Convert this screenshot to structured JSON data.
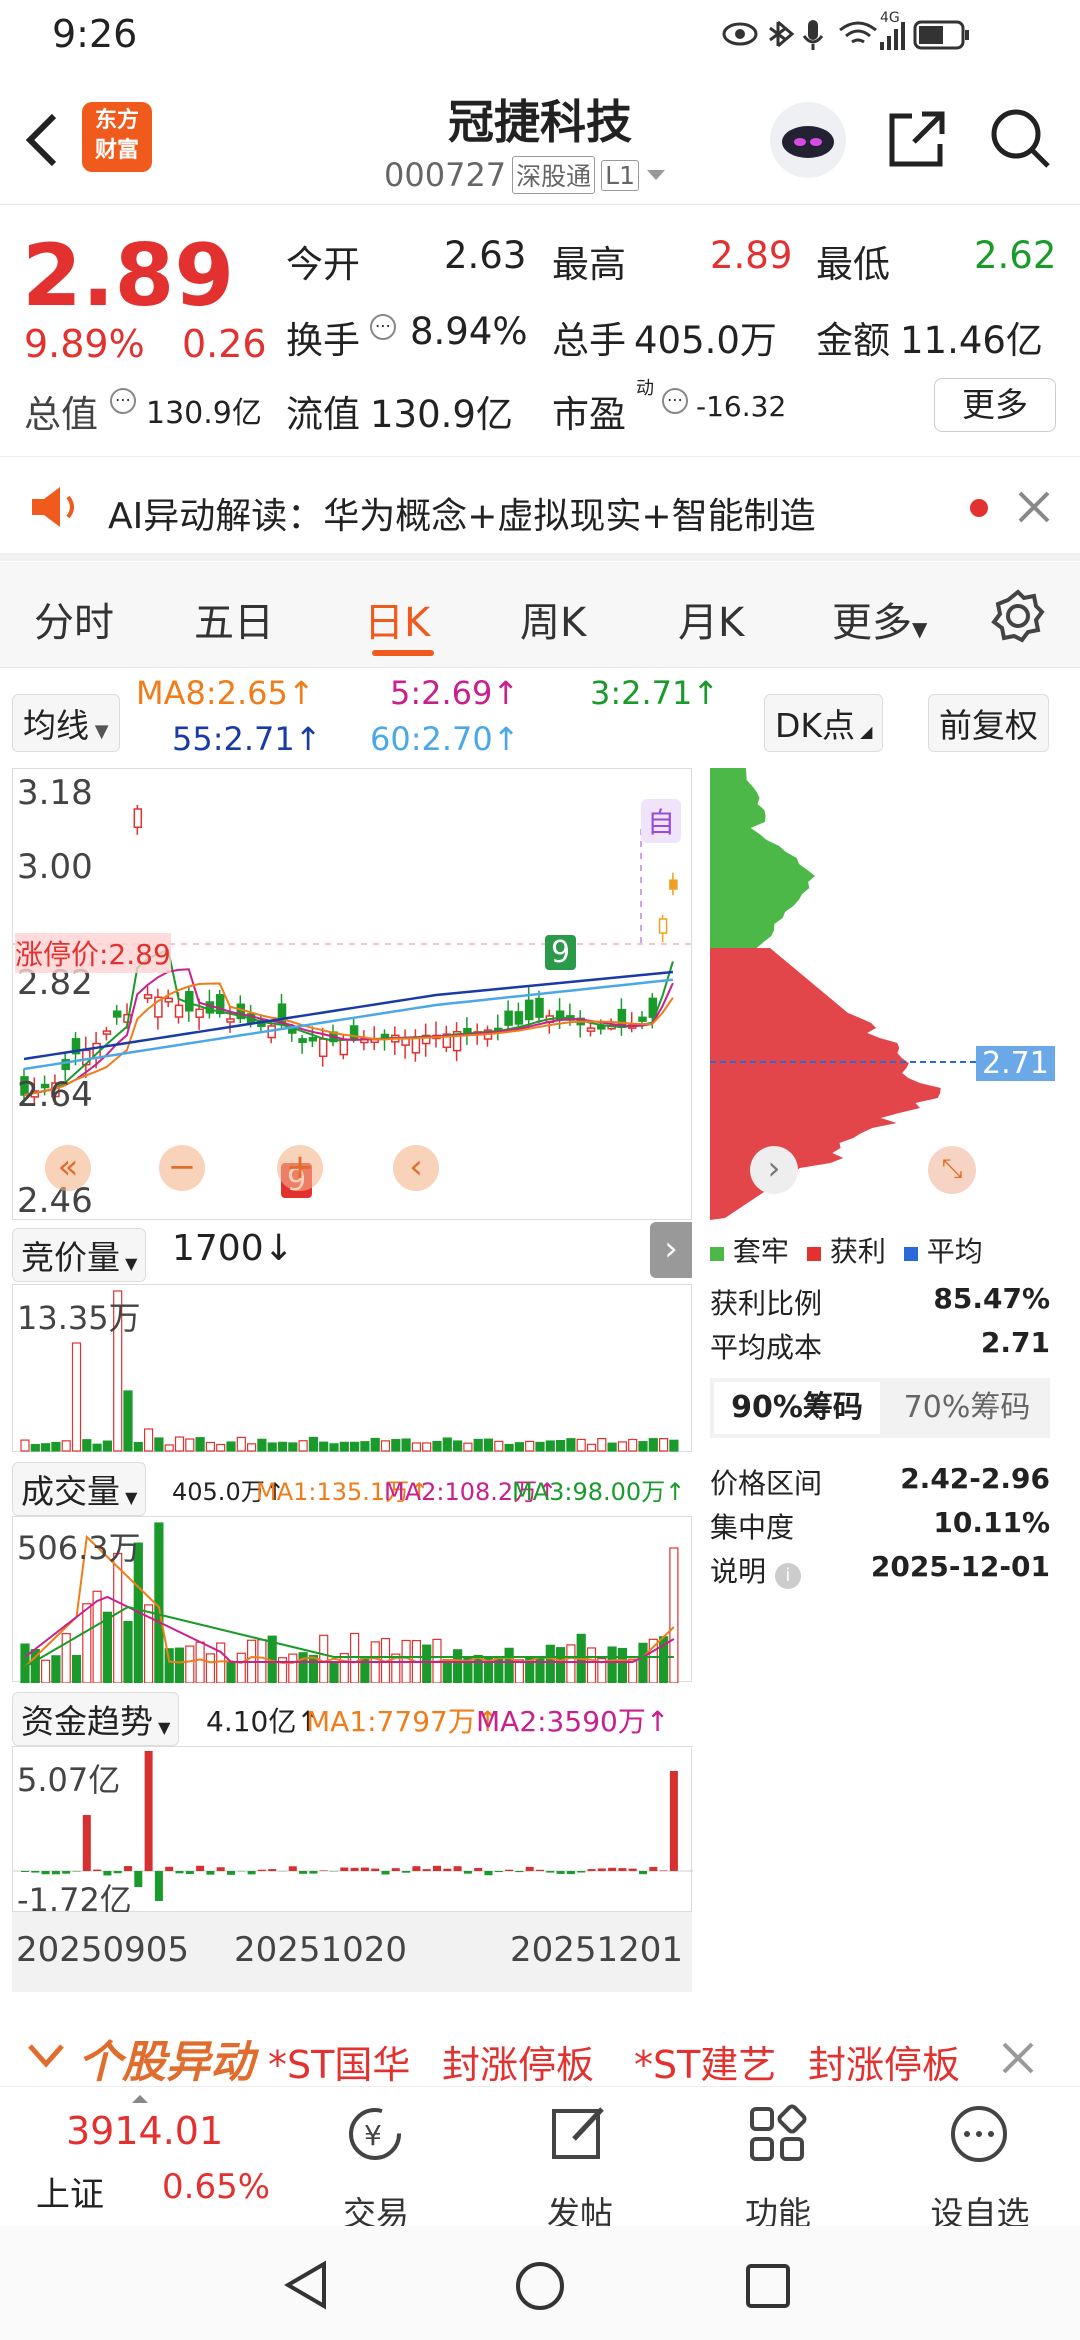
{
  "status": {
    "time": "9:26",
    "net": "4G"
  },
  "header": {
    "logo_line1": "东方",
    "logo_line2": "财富",
    "name": "冠捷科技",
    "code": "000727",
    "tag": "深股通",
    "level": "L1"
  },
  "quote": {
    "price": "2.89",
    "pct": "9.89%",
    "chg": "0.26",
    "open_l": "今开",
    "open_v": "2.63",
    "high_l": "最高",
    "high_v": "2.89",
    "low_l": "最低",
    "low_v": "2.62",
    "turn_l": "换手",
    "turn_v": "8.94%",
    "vol_l": "总手",
    "vol_v": "405.0万",
    "amt_l": "金额",
    "amt_v": "11.46亿",
    "mcap_l": "总值",
    "mcap_v": "130.9亿",
    "fcap_l": "流值",
    "fcap_v": "130.9亿",
    "pe_l": "市盈",
    "pe_sup": "动",
    "pe_v": "-16.32",
    "more": "更多"
  },
  "banner": {
    "text": "AI异动解读：华为概念+虚拟现实+智能制造"
  },
  "tabs": [
    "分时",
    "五日",
    "日K",
    "周K",
    "月K",
    "更多"
  ],
  "ma": {
    "select": "均线",
    "ma8": "MA8:2.65↑",
    "ma5": "5:2.69↑",
    "ma3": "3:2.71↑",
    "ma55": "55:2.71↑",
    "ma60": "60:2.70↑",
    "dk": "DK点",
    "fq": "前复权"
  },
  "kchart": {
    "y1": "3.18",
    "y2": "3.00",
    "y3": "2.82",
    "y4": "2.64",
    "y5": "2.46",
    "limit": "涨停价:2.89",
    "zi": "自",
    "nine_a": "9",
    "nine_b": "9"
  },
  "chip": {
    "avg_label": "2.71",
    "legend": [
      "套牢",
      "获利",
      "平均"
    ],
    "rows": [
      [
        "获利比例",
        "85.47%"
      ],
      [
        "平均成本",
        "2.71"
      ]
    ],
    "tab1": "90%筹码",
    "tab2": "70%筹码",
    "rows2": [
      [
        "价格区间",
        "2.42-2.96"
      ],
      [
        "集中度",
        "10.11%"
      ],
      [
        "说明",
        "2025-12-01"
      ]
    ]
  },
  "auction": {
    "select": "竞价量",
    "val": "1700↓",
    "ymax": "13.35万"
  },
  "volume": {
    "select": "成交量",
    "total": "405.0万↑",
    "ma1": "MA1:135.1万↑",
    "ma2": "MA2:108.2万↑",
    "ma3": "MA3:98.00万↑",
    "ymax": "506.3万"
  },
  "fund": {
    "select": "资金趋势",
    "total": "4.10亿↑",
    "ma1": "MA1:7797万↑",
    "ma2": "MA2:3590万↑",
    "ymax": "5.07亿",
    "ymin": "-1.72亿"
  },
  "dates": [
    "20250905",
    "20251020",
    "20251201"
  ],
  "ticker": {
    "title": "个股异动",
    "items": [
      "*ST国华",
      "封涨停板",
      "*ST建艺",
      "封涨停板"
    ]
  },
  "bottom": {
    "index_val": "3914.01",
    "index_name": "上证",
    "index_pct": "0.65%",
    "trade": "交易",
    "post": "发帖",
    "func": "功能",
    "watch": "设自选"
  },
  "colors": {
    "red": "#e2312f",
    "green": "#1a9a2b",
    "orange": "#f07d1a",
    "blue": "#1a3aa8",
    "lightblue": "#4aa8e8",
    "magenta": "#c8208c"
  }
}
